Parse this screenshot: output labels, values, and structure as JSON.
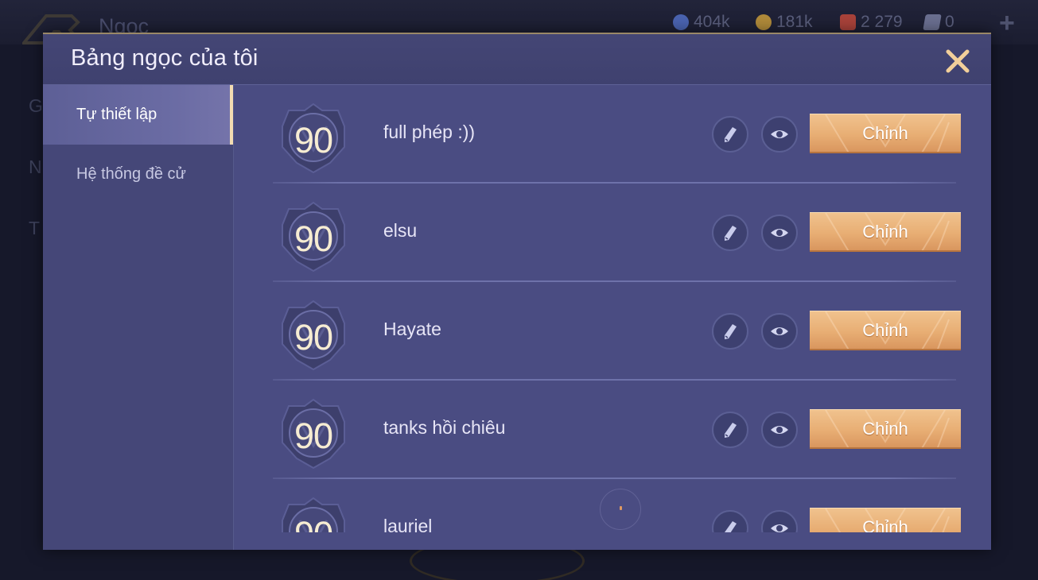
{
  "background": {
    "title": "Ngọc",
    "currencies": [
      {
        "icon": "blue-gem-icon",
        "value": "404k",
        "color": "#4a63b0"
      },
      {
        "icon": "gold-coin-icon",
        "value": "181k",
        "color": "#b08a3a"
      },
      {
        "icon": "red-voucher-icon",
        "value": "2 279",
        "color": "#a8423a"
      },
      {
        "icon": "card-ticket-icon",
        "value": "0",
        "color": "#6a6f90"
      }
    ],
    "side_letters": [
      "G",
      "N",
      "T"
    ]
  },
  "modal": {
    "title": "Bảng ngọc của tôi",
    "close_icon": "close-x-icon"
  },
  "sidebar": {
    "tabs": [
      {
        "label": "Tự thiết lập",
        "active": true
      },
      {
        "label": "Hệ thống đề cử",
        "active": false
      }
    ]
  },
  "rune_pages": [
    {
      "level": "90",
      "name": "full phép :))",
      "action": "Chỉnh"
    },
    {
      "level": "90",
      "name": "elsu",
      "action": "Chỉnh"
    },
    {
      "level": "90",
      "name": "Hayate",
      "action": "Chỉnh"
    },
    {
      "level": "90",
      "name": "tanks hồi chiêu",
      "action": "Chỉnh"
    },
    {
      "level": "90",
      "name": "lauriel",
      "action": "Chỉnh"
    }
  ],
  "colors": {
    "accent_orange": "#e8ae74",
    "modal_bg": "#4a4c82",
    "active_tab_indicator": "#f3dcb2"
  }
}
